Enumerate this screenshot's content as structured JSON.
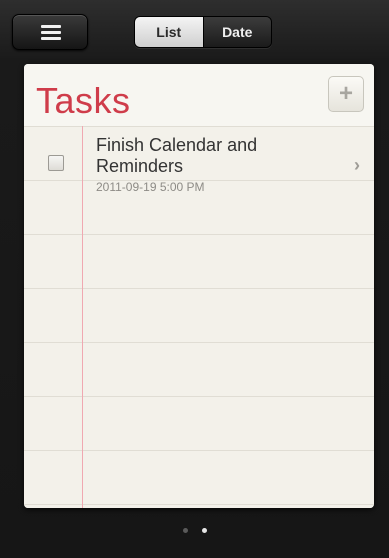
{
  "segments": {
    "list_label": "List",
    "date_label": "Date",
    "selected": "List"
  },
  "paper": {
    "title": "Tasks",
    "add_symbol": "+"
  },
  "tasks": [
    {
      "title": "Finish Calendar and Reminders",
      "date": "2011-09-19 5:00 PM",
      "completed": false
    }
  ],
  "page_indicator": {
    "pages": 2,
    "current": 2
  },
  "colors": {
    "title_red": "#cf3c4a",
    "margin_line": "#f0a8b1",
    "paper": "#f5f3ec"
  },
  "icons": {
    "menu": "menu-icon",
    "add": "plus-icon",
    "disclosure": "chevron-right-icon",
    "checkbox": "checkbox-icon"
  }
}
